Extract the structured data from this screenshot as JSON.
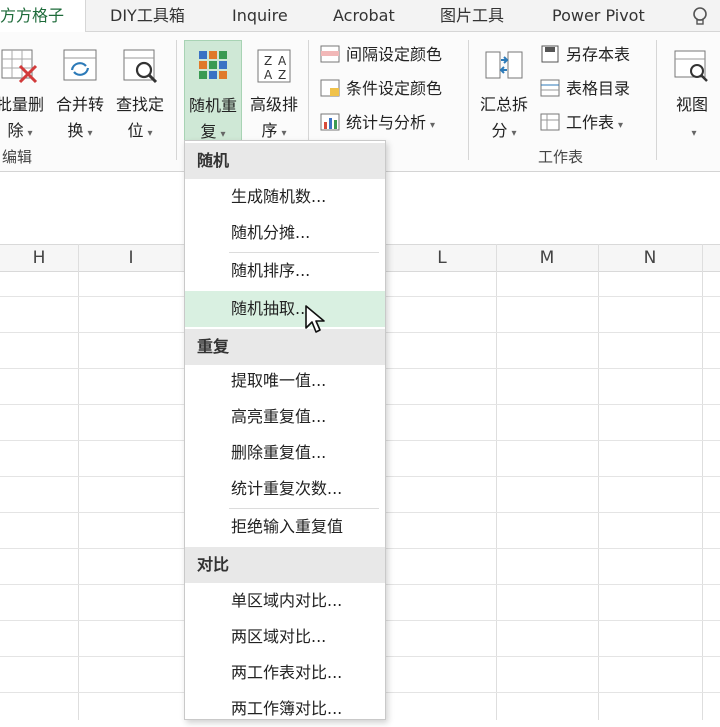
{
  "tabs": [
    "方方格子",
    "DIY工具箱",
    "Inquire",
    "Acrobat",
    "图片工具",
    "Power Pivot"
  ],
  "tell_me_icon": "lightbulb-icon",
  "ribbon": {
    "edit_group": {
      "batch_delete": {
        "line1": "批量删",
        "line2": "除"
      },
      "merge_convert": {
        "line1": "合并转",
        "line2": "换"
      },
      "find_locate": {
        "line1": "查找定",
        "line2": "位"
      },
      "label": "编辑"
    },
    "random_repeat": {
      "line1": "随机重",
      "line2": "复"
    },
    "advanced_sort": {
      "line1": "高级排",
      "line2": "序"
    },
    "color_group": [
      "间隔设定颜色",
      "条件设定颜色",
      "统计与分析"
    ],
    "worksheet_group": {
      "summarize_split": {
        "line1": "汇总拆",
        "line2": "分"
      },
      "items": [
        "另存本表",
        "表格目录",
        "工作表"
      ],
      "label": "工作表"
    },
    "view": {
      "line1": "视图"
    }
  },
  "columns": [
    "H",
    "I",
    "L",
    "M",
    "N"
  ],
  "menu": {
    "sections": [
      {
        "header": "随机",
        "items": [
          "生成随机数...",
          "随机分摊...",
          "随机排序...",
          "随机抽取..."
        ]
      },
      {
        "header": "重复",
        "items": [
          "提取唯一值...",
          "高亮重复值...",
          "删除重复值...",
          "统计重复次数...",
          "拒绝输入重复值"
        ]
      },
      {
        "header": "对比",
        "items": [
          "单区域内对比...",
          "两区域对比...",
          "两工作表对比...",
          "两工作簿对比..."
        ]
      }
    ],
    "hovered_item": "随机抽取..."
  },
  "colors": {
    "accent": "#1e6b3a",
    "selected_bg": "#cfe8d6",
    "hover_bg": "#d9f0e1"
  }
}
